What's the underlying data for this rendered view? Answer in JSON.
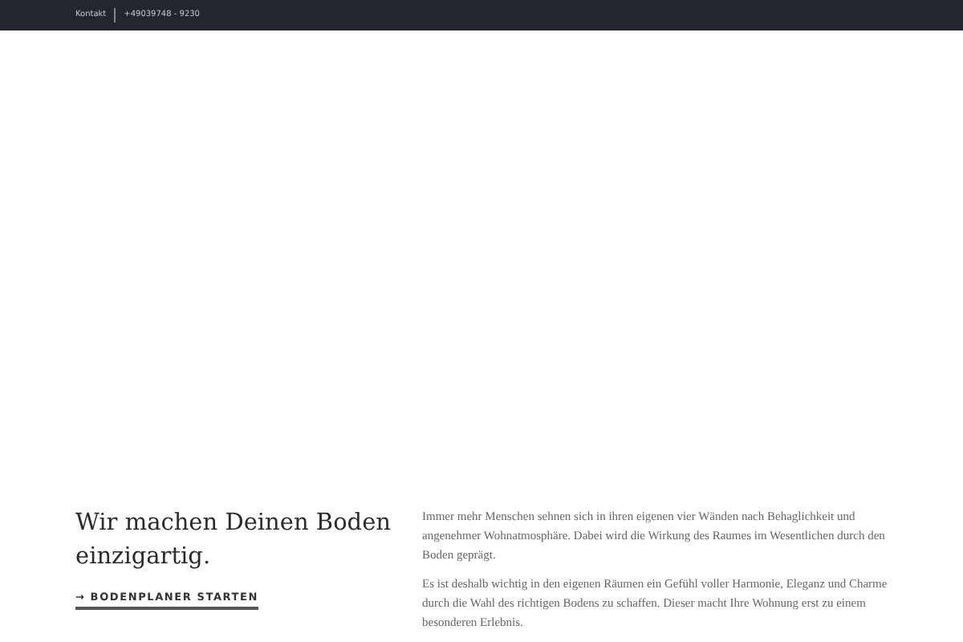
{
  "top_bar": {
    "contact_link": "Kontakt",
    "phone": "+49039748 - 9230"
  },
  "hero": {
    "heading": "Wir machen Deinen Boden einzigartig.",
    "cta": "→ BODENPLANER STARTEN",
    "paragraphs": [
      "Immer mehr Menschen sehnen sich in ihren eigenen vier Wänden nach Behaglichkeit und angenehmer Wohnatmosphäre. Dabei wird die Wirkung des Raumes im Wesentlichen durch den Boden geprägt.",
      "Es ist deshalb wichtig in den eigenen Räumen ein Gefühl voller Harmonie, Eleganz und Charme durch die Wahl des richtigen Bodens zu schaffen. Dieser macht Ihre Wohnung erst zu einem besonderen Erlebnis."
    ]
  }
}
